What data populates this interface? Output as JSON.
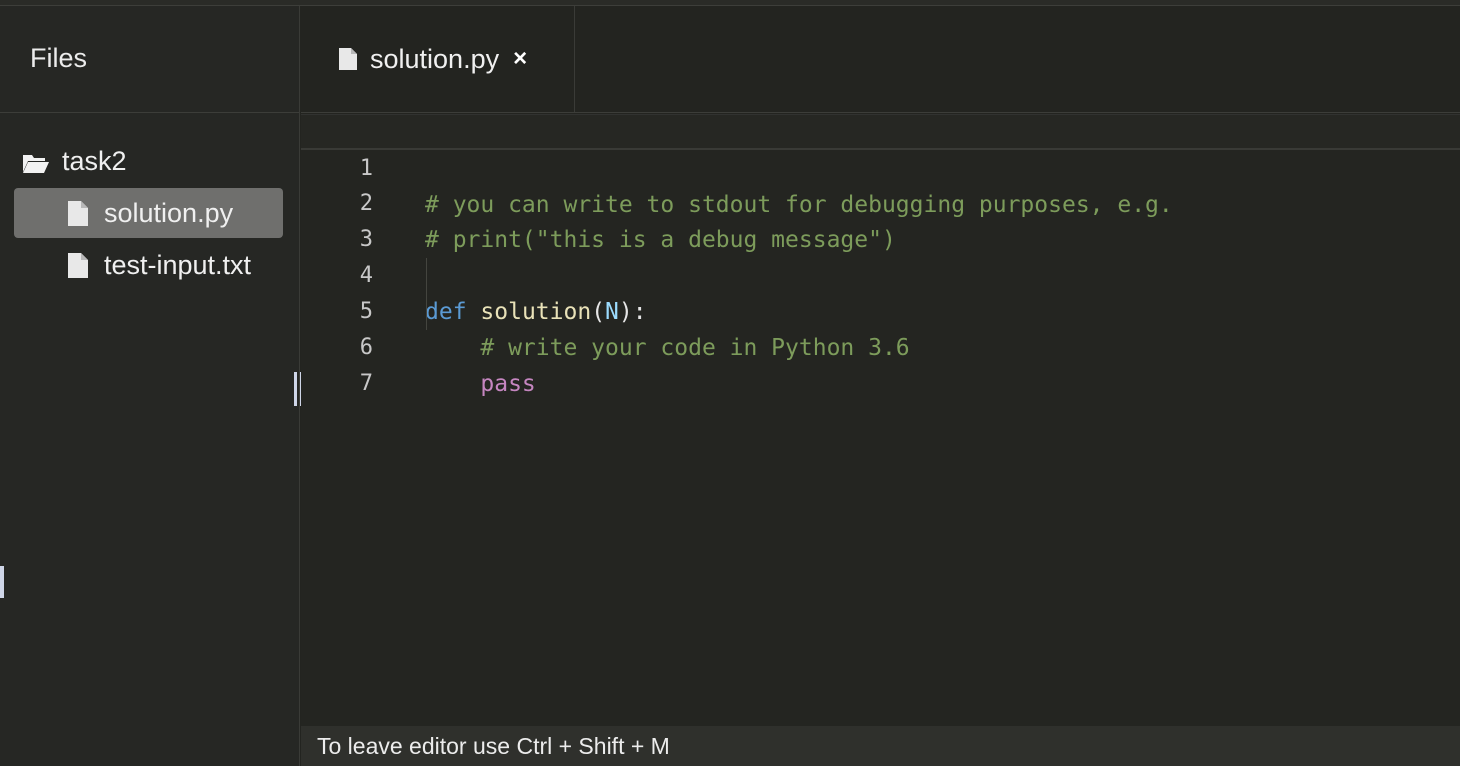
{
  "sidebar": {
    "title": "Files",
    "folder": {
      "name": "task2",
      "icon": "folder-open-icon"
    },
    "files": [
      {
        "name": "solution.py",
        "icon": "file-icon",
        "selected": true
      },
      {
        "name": "test-input.txt",
        "icon": "file-icon",
        "selected": false
      }
    ]
  },
  "tabs": [
    {
      "label": "solution.py",
      "icon": "file-icon",
      "close": "×"
    }
  ],
  "editor": {
    "language": "python",
    "colors": {
      "comment": "#7d9c5b",
      "keyword": "#5b9bd5",
      "function": "#e9e2b8",
      "param": "#9cdcfe",
      "pass": "#c586c0"
    },
    "lines": [
      {
        "number": "1",
        "text": "# you can write to stdout for debugging purposes, e.g."
      },
      {
        "number": "2",
        "text": "# print(\"this is a debug message\")"
      },
      {
        "number": "3",
        "text": ""
      },
      {
        "number": "4",
        "keyword": "def",
        "func": "solution",
        "open": "(",
        "param": "N",
        "close": "):"
      },
      {
        "number": "5",
        "text": "    # write your code in Python 3.6"
      },
      {
        "number": "6",
        "text": "    pass"
      },
      {
        "number": "7",
        "text": ""
      }
    ]
  },
  "statusbar": {
    "text": "To leave editor use Ctrl + Shift + M"
  }
}
